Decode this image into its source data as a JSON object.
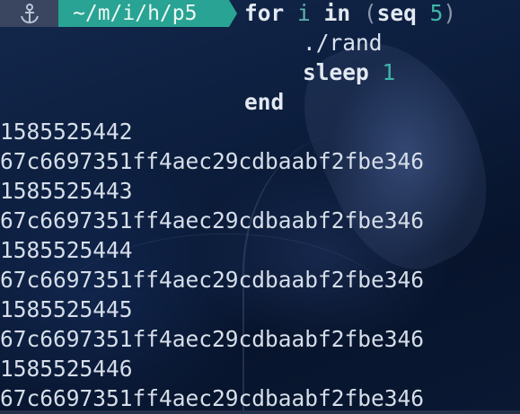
{
  "prompt": {
    "anchor_icon": "anchor-icon",
    "path": "~/m/i/h/p5",
    "for_kw": "for",
    "loop_var": "i",
    "in_kw": "in",
    "paren_open": "(",
    "seq_cmd": "seq",
    "seq_num": "5",
    "paren_close": ")"
  },
  "body_lines": [
    {
      "cmd": "./rand"
    },
    {
      "cmd": "sleep",
      "arg": "1"
    }
  ],
  "end_kw": "end",
  "output": [
    "1585525442",
    "67c6697351ff4aec29cdbaabf2fbe346",
    "1585525443",
    "67c6697351ff4aec29cdbaabf2fbe346",
    "1585525444",
    "67c6697351ff4aec29cdbaabf2fbe346",
    "1585525445",
    "67c6697351ff4aec29cdbaabf2fbe346",
    "1585525446",
    "67c6697351ff4aec29cdbaabf2fbe346"
  ],
  "colors": {
    "path_bg": "#29a393",
    "anchor_bg": "#3a4660",
    "number_accent": "#3fb5a8"
  }
}
